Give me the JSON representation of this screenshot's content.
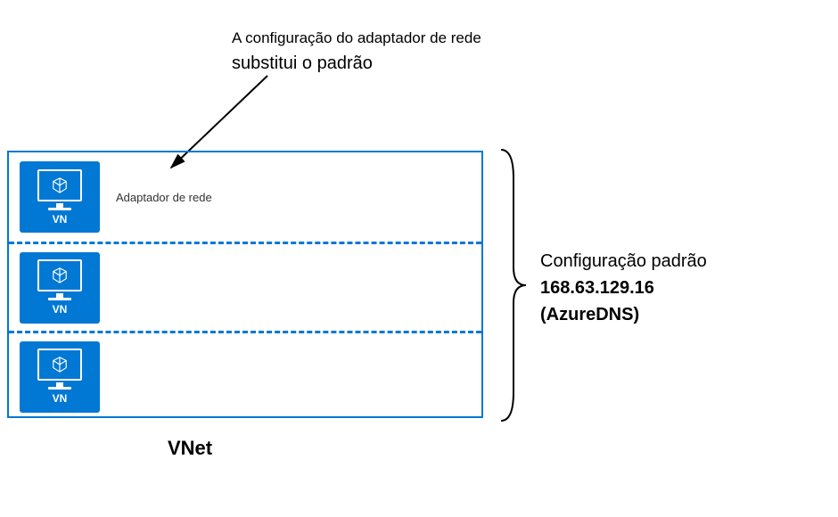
{
  "annotation": {
    "line1": "A configuração do adaptador de rede",
    "line2": "substitui o padrão"
  },
  "vnet": {
    "subnets": [
      {
        "vm_label": "VN",
        "adapter_label": "Adaptador de rede"
      },
      {
        "vm_label": "VN"
      },
      {
        "vm_label": "VN"
      }
    ],
    "label": "VNet"
  },
  "config": {
    "default_label": "Configuração padrão",
    "ip": "168.63.129.16",
    "dns": "(AzureDNS)"
  }
}
